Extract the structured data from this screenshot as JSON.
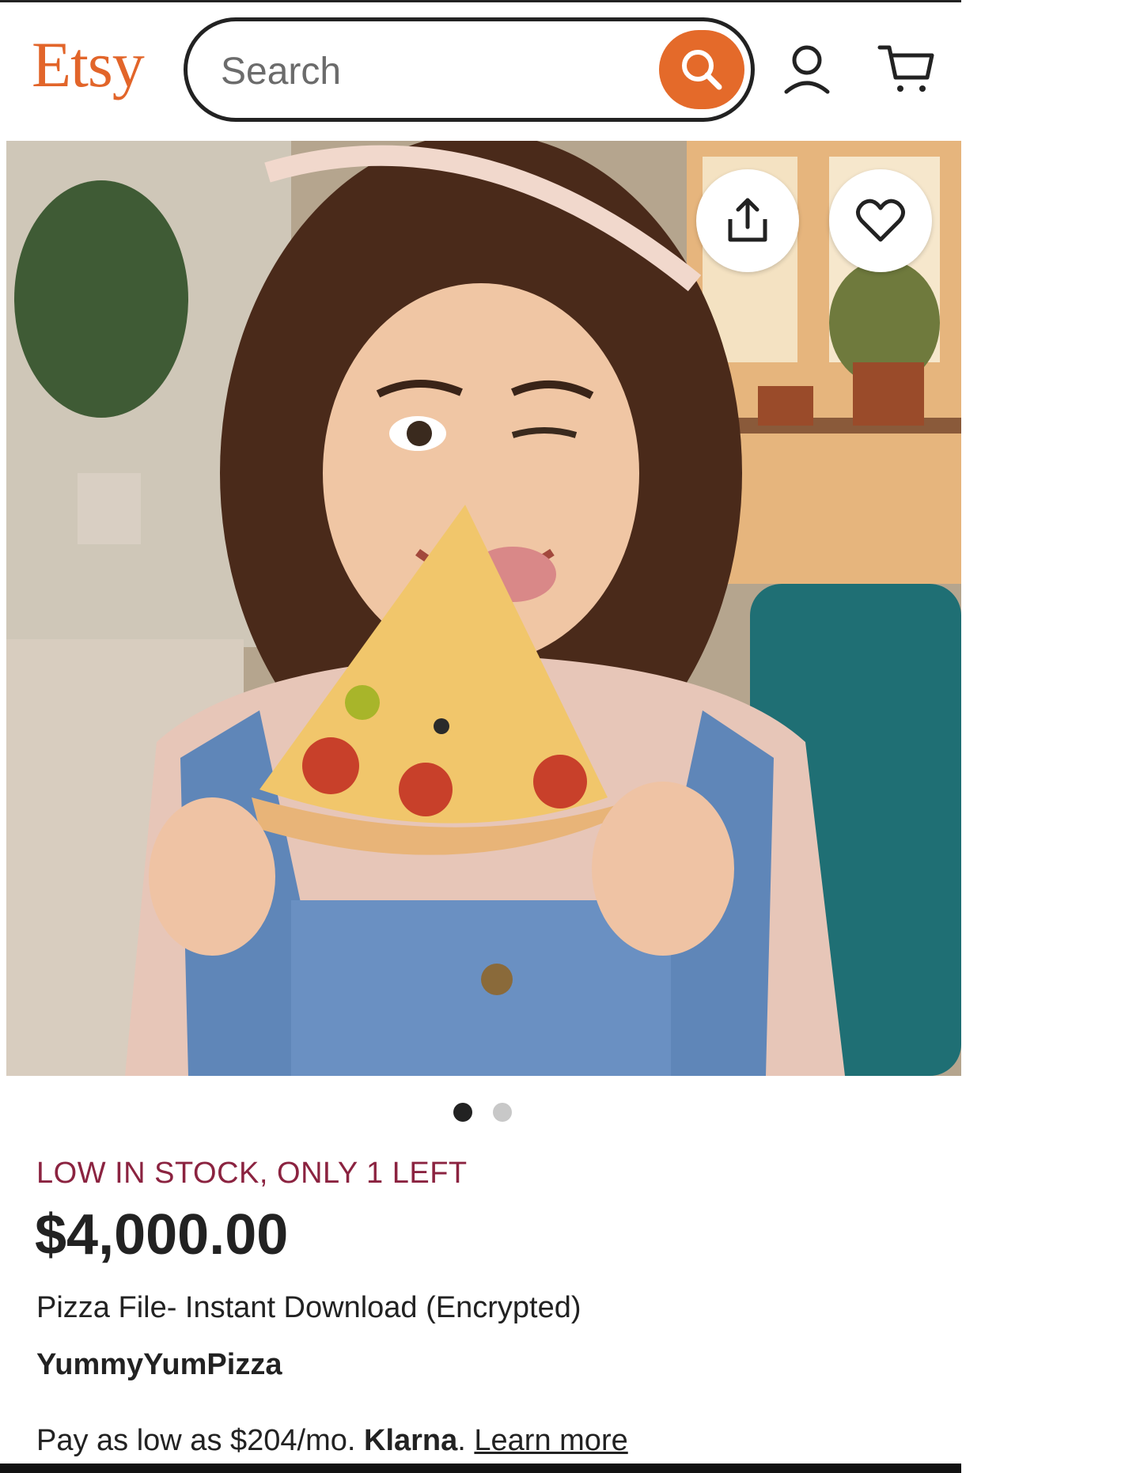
{
  "header": {
    "logo": "Etsy",
    "search_placeholder": "Search",
    "search_icon": "search-icon",
    "account_icon": "user-icon",
    "cart_icon": "cart-icon",
    "brand_color": "#e2652a"
  },
  "gallery": {
    "image_description_icon": "product-photo",
    "share_icon": "share-icon",
    "favorite_icon": "heart-icon",
    "image_count": 2,
    "active_index": 1
  },
  "listing": {
    "stock_notice": "LOW IN STOCK, ONLY 1 LEFT",
    "price": "$4,000.00",
    "title": "Pizza File- Instant Download (Encrypted)",
    "shop_name": "YummyYumPizza",
    "installment_text": "Pay as low as $204/mo.",
    "installment_provider": "Klarna",
    "installment_sep": ".",
    "learn_more": "Learn more",
    "stock_color": "#8b2340"
  }
}
